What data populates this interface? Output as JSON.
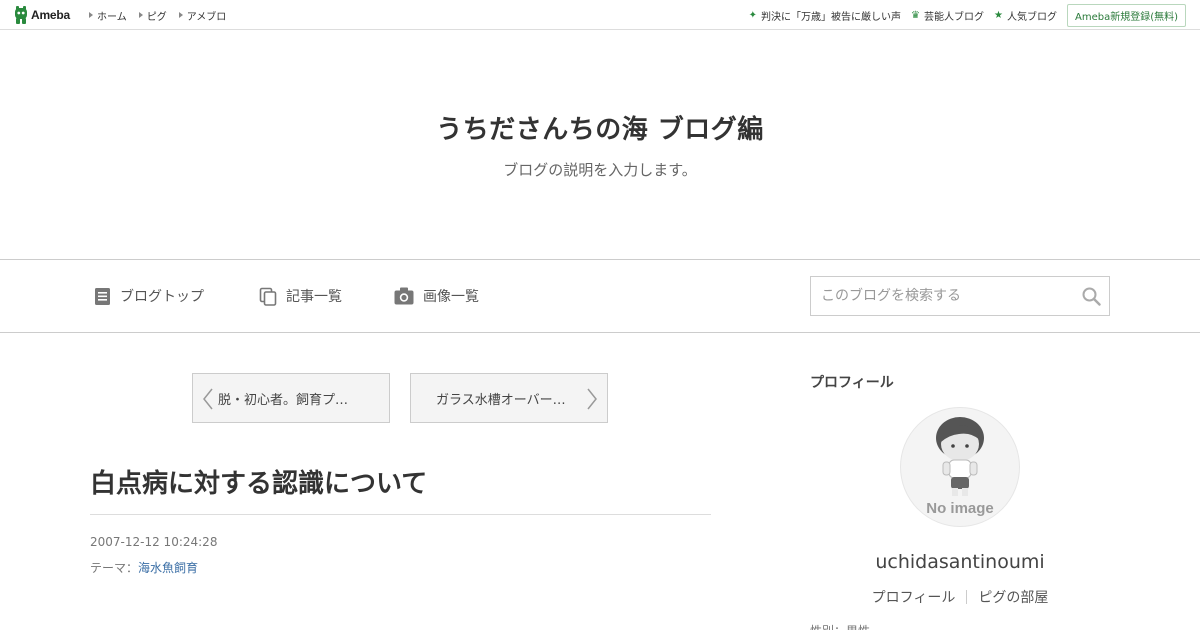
{
  "topbar": {
    "logo_text": "Ameba",
    "nav": [
      {
        "label": "ホーム"
      },
      {
        "label": "ピグ"
      },
      {
        "label": "アメブロ"
      }
    ],
    "right_links": [
      {
        "label": "判決に「万歳」被告に厳しい声",
        "icon": "sparkle-icon"
      },
      {
        "label": "芸能人ブログ",
        "icon": "crown-icon"
      },
      {
        "label": "人気ブログ",
        "icon": "star-icon"
      }
    ],
    "register_label": "Ameba新規登録(無料)"
  },
  "header": {
    "title": "うちださんちの海 ブログ編",
    "description": "ブログの説明を入力します。"
  },
  "navbar": {
    "items": [
      {
        "label": "ブログトップ",
        "icon": "document-icon"
      },
      {
        "label": "記事一覧",
        "icon": "copy-icon"
      },
      {
        "label": "画像一覧",
        "icon": "camera-icon"
      }
    ],
    "search_placeholder": "このブログを検索する"
  },
  "pager": {
    "prev_label": "脱・初心者。飼育プ…",
    "next_label": "ガラス水槽オーバー…"
  },
  "entry": {
    "title": "白点病に対する認識について",
    "date": "2007-12-12 10:24:28",
    "theme_prefix": "テーマ：",
    "theme_link": "海水魚飼育"
  },
  "sidebar": {
    "heading": "プロフィール",
    "avatar_text": "No image",
    "username": "uchidasantinoumi",
    "links": [
      {
        "label": "プロフィール"
      },
      {
        "label": "ピグの部屋"
      }
    ],
    "cut_text": "性別：男性"
  },
  "colors": {
    "accent_green": "#2a8a3e",
    "link_blue": "#3a6ea5",
    "border": "#cccccc"
  }
}
